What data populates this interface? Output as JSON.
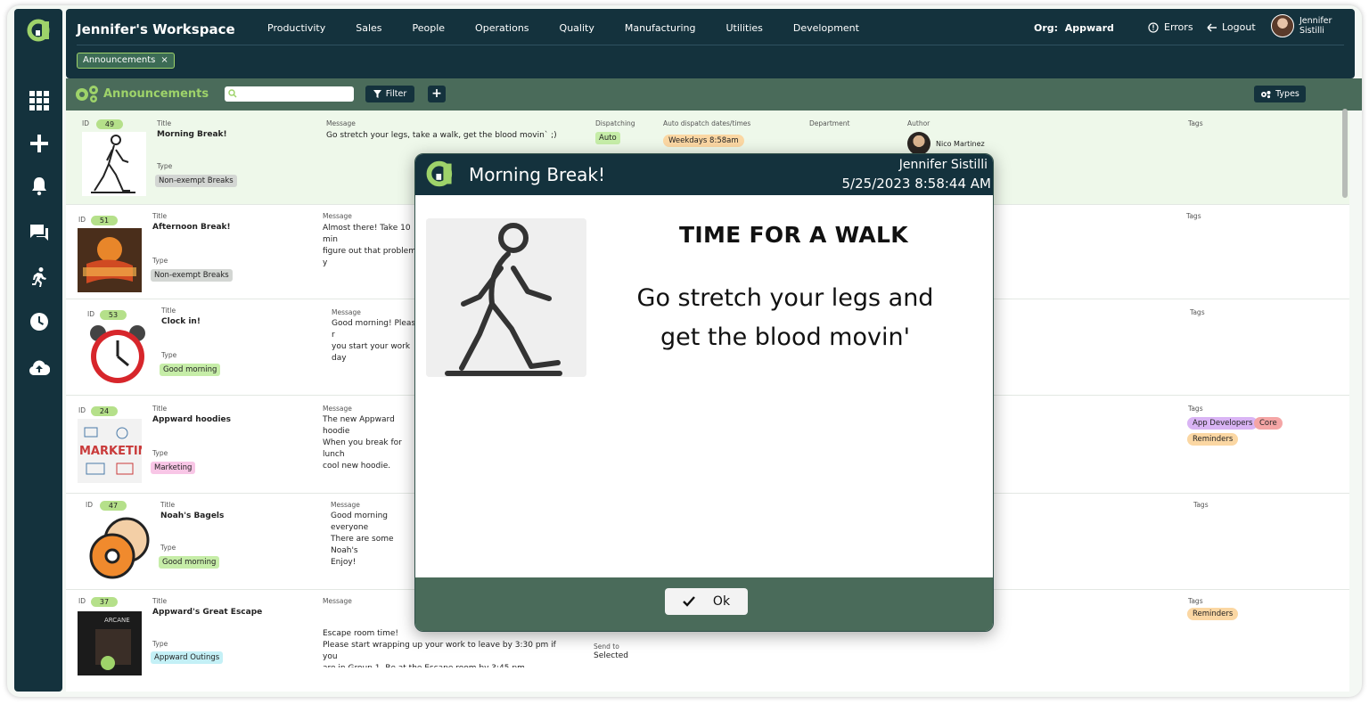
{
  "workspace": {
    "title": "Jennifer's Workspace"
  },
  "nav": [
    "Productivity",
    "Sales",
    "People",
    "Operations",
    "Quality",
    "Manufacturing",
    "Utilities",
    "Development"
  ],
  "org": {
    "label": "Org:",
    "value": "Appward"
  },
  "errors_label": "Errors",
  "logout_label": "Logout",
  "user": {
    "first": "Jennifer",
    "last": "Sistilli"
  },
  "open_tab": {
    "label": "Announcements",
    "close": "×"
  },
  "toolbar": {
    "title": "Announcements",
    "search_placeholder": "",
    "filter_label": "Filter",
    "add_label": "+",
    "types_label": "Types"
  },
  "labels": {
    "id": "ID",
    "title": "Title",
    "type": "Type",
    "message": "Message",
    "dispatching": "Dispatching",
    "auto_dispatch": "Auto dispatch dates/times",
    "department": "Department",
    "author": "Author",
    "tags": "Tags",
    "send_to": "Send to"
  },
  "rows": [
    {
      "id": "49",
      "title": "Morning Break!",
      "type": "Non-exempt Breaks",
      "message": "Go stretch your legs, take a walk, get the blood movin` ;)",
      "dispatching": "Auto",
      "auto_dispatch": "Weekdays 8:58am",
      "author": "Nico Martinez"
    },
    {
      "id": "51",
      "title": "Afternoon Break!",
      "type": "Non-exempt Breaks",
      "message": "Almost there! Take 10 min\nfigure out that problem y"
    },
    {
      "id": "53",
      "title": "Clock in!",
      "type": "Good morning",
      "message": "Good morning! Please r\nyou start your work day"
    },
    {
      "id": "24",
      "title": "Appward hoodies",
      "type": "Marketing",
      "message": "The new Appward hoodie\nWhen you break for lunch\ncool new hoodie.",
      "tags": [
        "App Developers",
        "Core",
        "Reminders"
      ]
    },
    {
      "id": "47",
      "title": "Noah's Bagels",
      "type": "Good morning",
      "message": "Good morning everyone\nThere are some Noah's\nEnjoy!"
    },
    {
      "id": "37",
      "title": "Appward's Great Escape",
      "type": "Appward Outings",
      "message": "Escape room time!\nPlease start wrapping up your work to leave by 3:30 pm if you\nare in Group 1. Be at the Escape room by 3:45 pm\nGroup 1",
      "send_to": "Selected",
      "tags": [
        "Reminders"
      ]
    }
  ],
  "modal": {
    "title": "Morning Break!",
    "user": "Jennifer Sistilli",
    "datetime": "5/25/2023  8:58:44 AM",
    "heading": "TIME FOR A WALK",
    "body": "Go stretch your legs and get the blood movin'",
    "ok_label": "Ok"
  },
  "colors": {
    "dark": "#14323d",
    "toolbar": "#4a6b5a",
    "accent": "#9ed36a"
  }
}
